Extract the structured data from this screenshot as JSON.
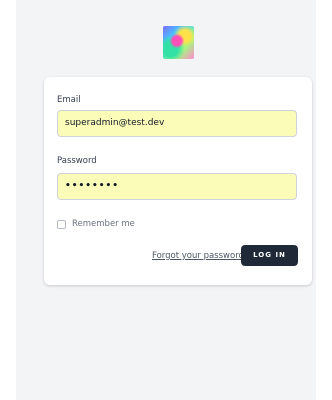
{
  "logo": {
    "caption": ""
  },
  "form": {
    "email_label": "Email",
    "email_value": "superadmin@test.dev",
    "password_label": "Password",
    "password_value": "••••••••",
    "remember_label": "Remember me",
    "forgot_label": "Forgot your password?",
    "login_label": "LOG IN"
  },
  "colors": {
    "page_bg": "#f3f4f6",
    "card_bg": "#ffffff",
    "input_autofill": "#fafcb7",
    "button_bg": "#1f2937"
  }
}
